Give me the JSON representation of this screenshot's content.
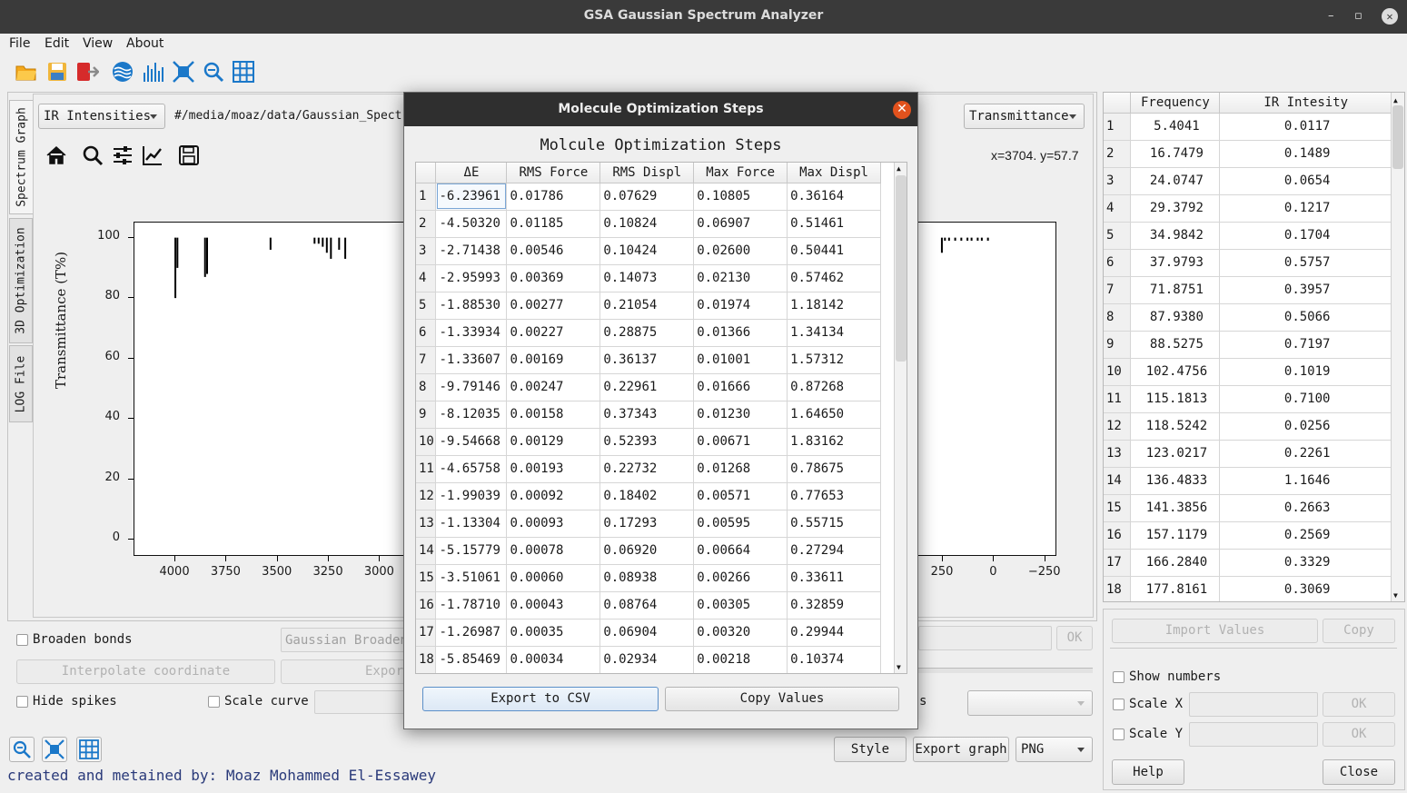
{
  "window": {
    "title": "GSA Gaussian Spectrum Analyzer",
    "min": "–",
    "max": "▫",
    "close": "✕"
  },
  "menu": {
    "file": "File",
    "edit": "Edit",
    "view": "View",
    "about": "About"
  },
  "toolbar": {
    "icons": [
      "open-folder-icon",
      "save-icon",
      "exit-icon",
      "wave-icon",
      "spectrum-bars-icon",
      "fit-view-icon",
      "zoom-out-icon",
      "grid-icon"
    ]
  },
  "tabs": {
    "spectrum": "Spectrum Graph",
    "optimization": "3D Optimization",
    "log": "LOG File"
  },
  "graph_panel": {
    "mode_select": "IR Intensities",
    "path": "#/media/moaz/data/Gaussian_Spectrum",
    "y_mode_select": "Transmittance",
    "coords": "x=3704. y=57.7"
  },
  "chart_data": {
    "type": "bar",
    "ylabel": "Transmittance (T%)",
    "ylim": [
      -5,
      105
    ],
    "xlim": [
      4200,
      -300
    ],
    "yticks": [
      "100",
      "80",
      "60",
      "40",
      "20",
      "0"
    ],
    "xticks": [
      "4000",
      "3750",
      "3500",
      "3250",
      "3000",
      "250",
      "0",
      "−250"
    ],
    "spikes": [
      {
        "x": 4000,
        "y": 80
      },
      {
        "x": 3990,
        "y": 90
      },
      {
        "x": 3855,
        "y": 87
      },
      {
        "x": 3845,
        "y": 88
      },
      {
        "x": 3535,
        "y": 96
      },
      {
        "x": 3320,
        "y": 98
      },
      {
        "x": 3300,
        "y": 98
      },
      {
        "x": 3280,
        "y": 97
      },
      {
        "x": 3260,
        "y": 95
      },
      {
        "x": 3240,
        "y": 93
      },
      {
        "x": 3200,
        "y": 96
      },
      {
        "x": 3170,
        "y": 93
      },
      {
        "x": 255,
        "y": 95
      },
      {
        "x": 240,
        "y": 99
      },
      {
        "x": 220,
        "y": 99
      },
      {
        "x": 190,
        "y": 99
      },
      {
        "x": 160,
        "y": 99
      },
      {
        "x": 130,
        "y": 99
      },
      {
        "x": 110,
        "y": 99
      },
      {
        "x": 80,
        "y": 99
      },
      {
        "x": 60,
        "y": 99
      },
      {
        "x": 30,
        "y": 99
      }
    ]
  },
  "controls": {
    "broaden": "Broaden bonds",
    "gaussian_placeholder": "Gaussian Broadening",
    "ok": "OK",
    "interpolate": "Interpolate coordinate",
    "export_csv_partial": "Export to CSV",
    "hide_spikes": "Hide spikes",
    "scale_curve": "Scale curve",
    "style": "Style",
    "export_graph": "Export graph",
    "format": "PNG",
    "credit": "created and metained by: Moaz Mohammed El-Essawey"
  },
  "dialog": {
    "title": "Molecule Optimization Steps",
    "heading": "Molcule Optimization Steps",
    "columns": [
      "ΔE",
      "RMS Force",
      "RMS Displ",
      "Max Force",
      "Max Displ"
    ],
    "rows": [
      [
        "-6.23961",
        "0.01786",
        "0.07629",
        "0.10805",
        "0.36164"
      ],
      [
        "-4.50320",
        "0.01185",
        "0.10824",
        "0.06907",
        "0.51461"
      ],
      [
        "-2.71438",
        "0.00546",
        "0.10424",
        "0.02600",
        "0.50441"
      ],
      [
        "-2.95993",
        "0.00369",
        "0.14073",
        "0.02130",
        "0.57462"
      ],
      [
        "-1.88530",
        "0.00277",
        "0.21054",
        "0.01974",
        "1.18142"
      ],
      [
        "-1.33934",
        "0.00227",
        "0.28875",
        "0.01366",
        "1.34134"
      ],
      [
        "-1.33607",
        "0.00169",
        "0.36137",
        "0.01001",
        "1.57312"
      ],
      [
        "-9.79146",
        "0.00247",
        "0.22961",
        "0.01666",
        "0.87268"
      ],
      [
        "-8.12035",
        "0.00158",
        "0.37343",
        "0.01230",
        "1.64650"
      ],
      [
        "-9.54668",
        "0.00129",
        "0.52393",
        "0.00671",
        "1.83162"
      ],
      [
        "-4.65758",
        "0.00193",
        "0.22732",
        "0.01268",
        "0.78675"
      ],
      [
        "-1.99039",
        "0.00092",
        "0.18402",
        "0.00571",
        "0.77653"
      ],
      [
        "-1.13304",
        "0.00093",
        "0.17293",
        "0.00595",
        "0.55715"
      ],
      [
        "-5.15779",
        "0.00078",
        "0.06920",
        "0.00664",
        "0.27294"
      ],
      [
        "-3.51061",
        "0.00060",
        "0.08938",
        "0.00266",
        "0.33611"
      ],
      [
        "-1.78710",
        "0.00043",
        "0.08764",
        "0.00305",
        "0.32859"
      ],
      [
        "-1.26987",
        "0.00035",
        "0.06904",
        "0.00320",
        "0.29944"
      ],
      [
        "-5.85469",
        "0.00034",
        "0.02934",
        "0.00218",
        "0.10374"
      ]
    ],
    "export_button": "Export to CSV",
    "copy_button": "Copy Values"
  },
  "freq_table": {
    "columns": [
      "Frequency",
      "IR Intesity"
    ],
    "rows": [
      [
        "5.4041",
        "0.0117"
      ],
      [
        "16.7479",
        "0.1489"
      ],
      [
        "24.0747",
        "0.0654"
      ],
      [
        "29.3792",
        "0.1217"
      ],
      [
        "34.9842",
        "0.1704"
      ],
      [
        "37.9793",
        "0.5757"
      ],
      [
        "71.8751",
        "0.3957"
      ],
      [
        "87.9380",
        "0.5066"
      ],
      [
        "88.5275",
        "0.7197"
      ],
      [
        "102.4756",
        "0.1019"
      ],
      [
        "115.1813",
        "0.7100"
      ],
      [
        "118.5242",
        "0.0256"
      ],
      [
        "123.0217",
        "0.2261"
      ],
      [
        "136.4833",
        "1.1646"
      ],
      [
        "141.3856",
        "0.2663"
      ],
      [
        "157.1179",
        "0.2569"
      ],
      [
        "166.2840",
        "0.3329"
      ],
      [
        "177.8161",
        "0.3069"
      ]
    ]
  },
  "right_controls": {
    "import": "Import Values",
    "copy": "Copy",
    "show_numbers": "Show numbers",
    "scale_x": "Scale X",
    "scale_y": "Scale Y",
    "ok": "OK",
    "help": "Help",
    "close": "Close"
  }
}
